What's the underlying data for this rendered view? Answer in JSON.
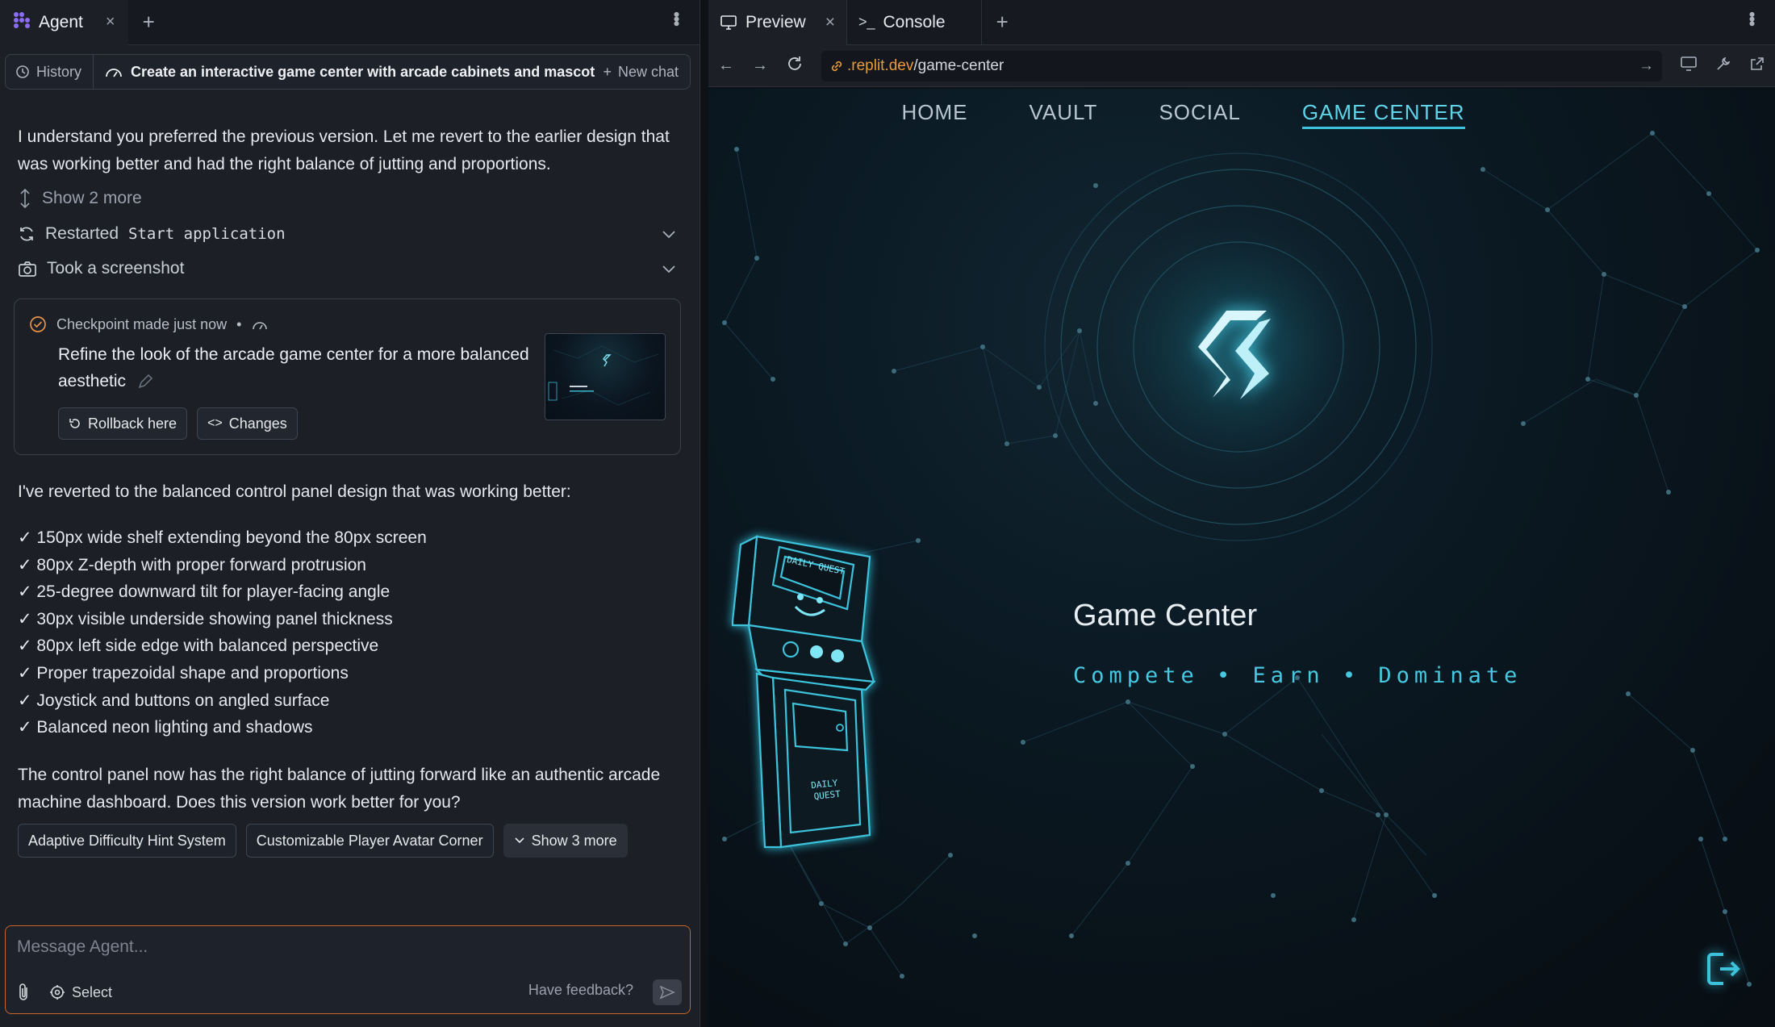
{
  "agent_tab": {
    "label": "Agent",
    "close": "×",
    "add": "+"
  },
  "chatbar": {
    "history_label": "History",
    "title": "Create an interactive game center with arcade cabinets and mascot",
    "new_chat_label": "New chat"
  },
  "messages": {
    "intro": "I understand you preferred the previous version. Let me revert to the earlier design that was working better and had the right balance of jutting and proportions.",
    "show_more": "Show 2 more",
    "restarted_prefix": "Restarted",
    "restarted_cmd": "Start application",
    "screenshot": "Took a screenshot",
    "reverted": "I've reverted to the balanced control panel design that was working better:",
    "checks": [
      "✓ 150px wide shelf extending beyond the 80px screen",
      "✓ 80px Z-depth with proper forward protrusion",
      "✓ 25-degree downward tilt for player-facing angle",
      "✓ 30px visible underside showing panel thickness",
      "✓ 80px left side edge with balanced perspective",
      "✓ Proper trapezoidal shape and proportions",
      "✓ Joystick and buttons on angled surface",
      "✓ Balanced neon lighting and shadows"
    ],
    "closing": "The control panel now has the right balance of jutting forward like an authentic arcade machine dashboard. Does this version work better for you?"
  },
  "checkpoint": {
    "header": "Checkpoint made just now",
    "bullet": "•",
    "description": "Refine the look of the arcade game center for a more balanced aesthetic",
    "rollback_label": "Rollback here",
    "changes_label": "Changes"
  },
  "suggestions": {
    "items": [
      "Adaptive Difficulty Hint System",
      "Customizable Player Avatar Corner"
    ],
    "more_label": "Show 3 more"
  },
  "composer": {
    "placeholder": "Message Agent...",
    "select_label": "Select",
    "feedback_label": "Have feedback?"
  },
  "right_tabs": {
    "preview": "Preview",
    "console": "Console",
    "close": "×",
    "add": "+"
  },
  "url": {
    "host": ".replit.dev",
    "path": "/game-center"
  },
  "site": {
    "nav": [
      "HOME",
      "VAULT",
      "SOCIAL",
      "GAME CENTER"
    ],
    "active_nav": "GAME CENTER",
    "title": "Game Center",
    "subtitle": "Compete • Earn • Dominate",
    "cabinet_label": "DAILY QUEST",
    "cabinet_label_lower_1": "DAILY",
    "cabinet_label_lower_2": "QUEST"
  },
  "colors": {
    "accent_orange": "#c7662a",
    "neon_cyan": "#45c8e0",
    "pane_bg": "#1c1f26"
  }
}
